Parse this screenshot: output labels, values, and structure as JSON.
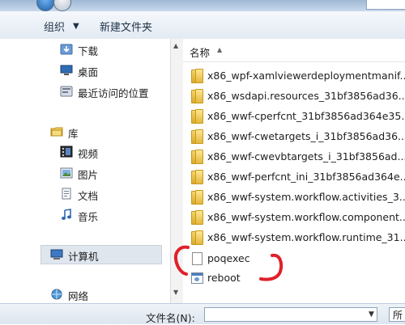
{
  "toolbar": {
    "organize_label": "组织",
    "organize_arrow": "▼",
    "new_folder_label": "新建文件夹"
  },
  "navigation": {
    "items": [
      {
        "label": "下载",
        "icon": "download-folder-icon"
      },
      {
        "label": "桌面",
        "icon": "desktop-icon"
      },
      {
        "label": "最近访问的位置",
        "icon": "recent-places-icon"
      },
      {
        "label": "库",
        "icon": "library-icon"
      },
      {
        "label": "视频",
        "icon": "video-library-icon"
      },
      {
        "label": "图片",
        "icon": "pictures-library-icon"
      },
      {
        "label": "文档",
        "icon": "documents-library-icon"
      },
      {
        "label": "音乐",
        "icon": "music-library-icon"
      },
      {
        "label": "计算机",
        "icon": "computer-icon"
      },
      {
        "label": "网络",
        "icon": "network-icon"
      }
    ]
  },
  "file_list": {
    "column_name": "名称",
    "sort_indicator": "▲",
    "files": [
      {
        "name": "x86_wpf-xamlviewerdeploymentmanif...",
        "type": "folder"
      },
      {
        "name": "x86_wsdapi.resources_31bf3856ad36...",
        "type": "folder"
      },
      {
        "name": "x86_wwf-cperfcnt_31bf3856ad364e35...",
        "type": "folder"
      },
      {
        "name": "x86_wwf-cwetargets_i_31bf3856ad36...",
        "type": "folder"
      },
      {
        "name": "x86_wwf-cwevbtargets_i_31bf3856ad...",
        "type": "folder"
      },
      {
        "name": "x86_wwf-perfcnt_ini_31bf3856ad364e...",
        "type": "folder"
      },
      {
        "name": "x86_wwf-system.workflow.activities_3...",
        "type": "folder"
      },
      {
        "name": "x86_wwf-system.workflow.component...",
        "type": "folder"
      },
      {
        "name": "x86_wwf-system.workflow.runtime_31...",
        "type": "folder"
      },
      {
        "name": "poqexec",
        "type": "file"
      },
      {
        "name": "reboot",
        "type": "executable"
      }
    ]
  },
  "filename_bar": {
    "label": "文件名(N):",
    "value": "",
    "dropdown_arrow": "▼",
    "type_label": "所"
  },
  "colors": {
    "annotation_red": "#e0202a",
    "selected_bg": "#dfe6ee"
  }
}
